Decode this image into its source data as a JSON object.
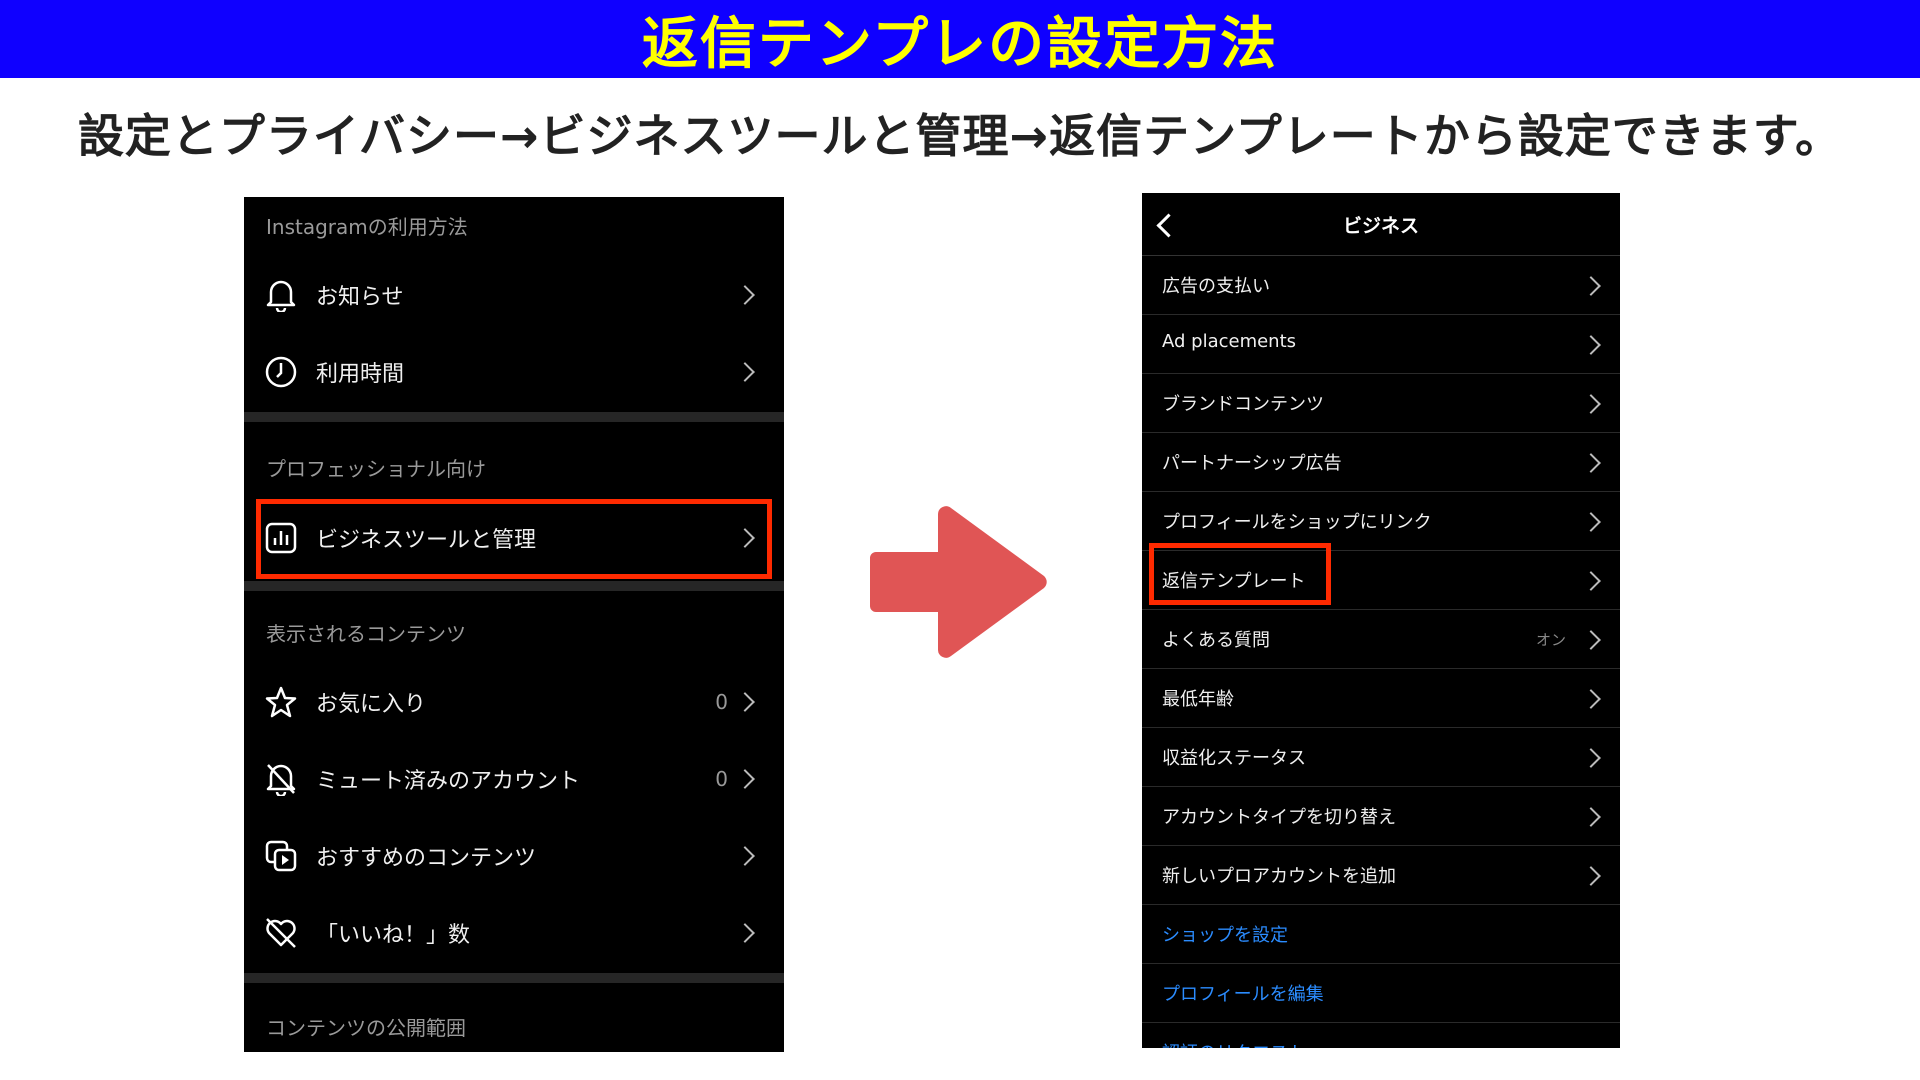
{
  "header": {
    "title": "返信テンプレの設定方法",
    "subtitle": "設定とプライバシー→ビジネスツールと管理→返信テンプレートから設定できます。"
  },
  "left_screen": {
    "sections": [
      {
        "label": "Instagramの利用方法",
        "items": [
          {
            "label": "お知らせ",
            "icon": "bell-icon"
          },
          {
            "label": "利用時間",
            "icon": "clock-icon"
          }
        ]
      },
      {
        "label": "プロフェッショナル向け",
        "items": [
          {
            "label": "ビジネスツールと管理",
            "icon": "chart-icon",
            "highlighted": true
          }
        ]
      },
      {
        "label": "表示されるコンテンツ",
        "items": [
          {
            "label": "お気に入り",
            "icon": "star-icon",
            "count": "0"
          },
          {
            "label": "ミュート済みのアカウント",
            "icon": "bell-off-icon",
            "count": "0"
          },
          {
            "label": "おすすめのコンテンツ",
            "icon": "suggested-content-icon"
          },
          {
            "label": "「いいね！」数",
            "icon": "heart-off-icon"
          }
        ]
      },
      {
        "label": "コンテンツの公開範囲",
        "items": []
      }
    ]
  },
  "right_screen": {
    "title": "ビジネス",
    "items": [
      {
        "label": "広告の支払い"
      },
      {
        "label": "Ad placements"
      },
      {
        "label": "ブランドコンテンツ"
      },
      {
        "label": "パートナーシップ広告"
      },
      {
        "label": "プロフィールをショップにリンク"
      },
      {
        "label": "返信テンプレート",
        "highlighted": true
      },
      {
        "label": "よくある質問",
        "status": "オン"
      },
      {
        "label": "最低年齢"
      },
      {
        "label": "収益化ステータス"
      },
      {
        "label": "アカウントタイプを切り替え"
      },
      {
        "label": "新しいプロアカウントを追加"
      },
      {
        "label": "ショップを設定",
        "link": true
      },
      {
        "label": "プロフィールを編集",
        "link": true
      },
      {
        "label": "認証のリクエスト",
        "link": true
      }
    ]
  },
  "colors": {
    "title_bar": "#0f00ff",
    "title_text": "#ffff00",
    "highlight": "#ff2a00",
    "arrow": "#e05555",
    "link": "#2b8cff"
  }
}
